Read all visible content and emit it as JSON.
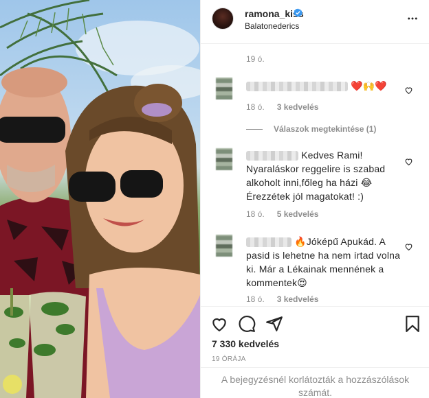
{
  "post": {
    "username": "ramona_kiss",
    "location": "Balatonederics"
  },
  "comments": [
    {
      "meta_time": "19 ó.",
      "meta_likes": ""
    },
    {
      "text": "❤️🙌❤️",
      "meta_time": "18 ó.",
      "meta_likes": "3 kedvelés"
    },
    {
      "text": "Kedves Rami! Nyaraláskor reggelire is szabad alkoholt inni,főleg ha házi 😂 Érezzétek jól magatokat! :)",
      "meta_time": "18 ó.",
      "meta_likes": "5 kedvelés"
    },
    {
      "text": "🔥Jóképű Apukád. A pasid is lehetne ha nem írtad volna ki. Már a Lékainak mennének a kommentek😍",
      "meta_time": "18 ó.",
      "meta_likes": "3 kedvelés"
    }
  ],
  "replies_label": "Válaszok megtekintése (1)",
  "likes_count": "7 330 kedvelés",
  "post_time": "19 ÓRÁJA",
  "comments_limited": "A bejegyzésnél korlátozták a hozzászólások számát.",
  "colors": {
    "verified": "#3897f0",
    "text": "#262626",
    "muted": "#8e8e8e",
    "border": "#efefef"
  },
  "icons": [
    "verified-badge-icon",
    "more-options-icon",
    "heart-icon",
    "comment-icon",
    "share-icon",
    "bookmark-icon"
  ]
}
